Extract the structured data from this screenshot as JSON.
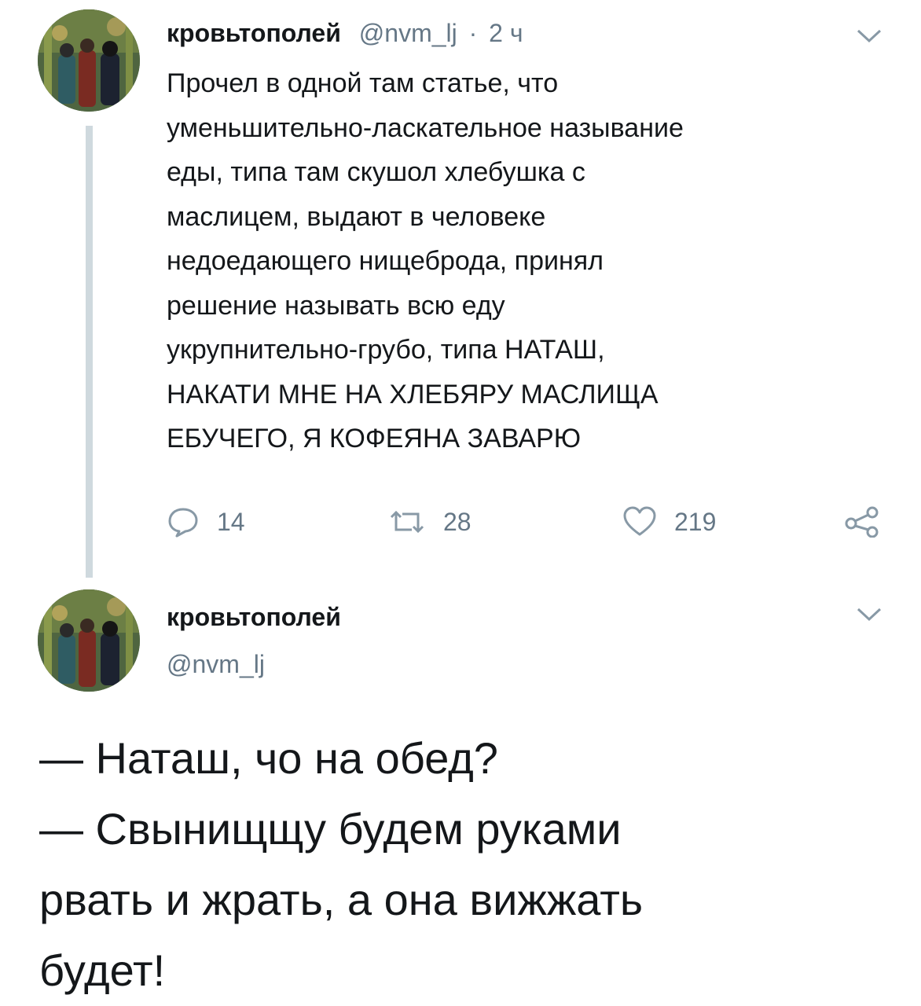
{
  "tweet1": {
    "author_name": "кровьтополей",
    "handle": "@nvm_lj",
    "separator": "·",
    "time": "2 ч",
    "text_lines": [
      "Прочел в одной там статье, что",
      "уменьшительно-ласкательное называние",
      "еды, типа там скушол хлебушка с",
      "маслицем, выдают в человеке",
      "недоедающего нищеброда, принял",
      "решение называть всю еду",
      "укрупнительно-грубо, типа НАТАШ,",
      "НАКАТИ МНЕ НА ХЛЕБЯРУ МАСЛИЩА",
      "ЕБУЧЕГО, Я КОФЕЯНА ЗАВАРЮ"
    ],
    "actions": {
      "reply_icon": "reply-icon",
      "reply_count": "14",
      "retweet_icon": "retweet-icon",
      "retweet_count": "28",
      "like_icon": "heart-icon",
      "like_count": "219",
      "share_icon": "share-icon"
    }
  },
  "tweet2": {
    "author_name": "кровьтополей",
    "handle": "@nvm_lj",
    "text_lines": [
      "— Наташ, чо на обед?",
      "— Свынищщу будем руками",
      "рвать и жрать, а она вижжать",
      "будет!"
    ]
  },
  "colors": {
    "text": "#14171a",
    "muted": "#657786",
    "thread_line": "#cfd9de",
    "background": "#ffffff"
  }
}
